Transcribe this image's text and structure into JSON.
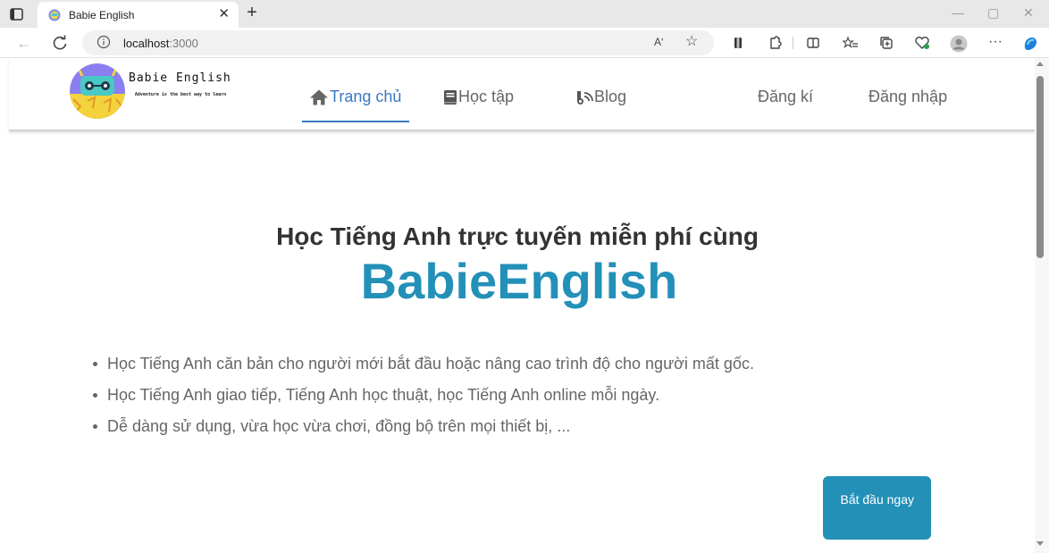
{
  "browser": {
    "tab_title": "Babie English",
    "url_host": "localhost",
    "url_port": ":3000",
    "read_aloud_label": "Aʹ"
  },
  "site": {
    "brand_name": "Babie English",
    "brand_slogan": "Adventure is the best way to learn",
    "nav": {
      "home": "Trang chủ",
      "study": "Học tập",
      "blog": "Blog",
      "register": "Đăng kí",
      "login": "Đăng nhập"
    },
    "hero": {
      "title": "Học Tiếng Anh trực tuyến miễn phí cùng",
      "brand": "BabieEnglish",
      "features": [
        "Học Tiếng Anh căn bản cho người mới bắt đầu hoặc nâng cao trình độ cho người mất gốc.",
        "Học Tiếng Anh giao tiếp, Tiếng Anh học thuật, học Tiếng Anh online mỗi ngày.",
        "Dễ dàng sử dụng, vừa học vừa chơi, đồng bộ trên mọi thiết bị, ..."
      ],
      "start_button": "Bắt đầu ngay"
    }
  },
  "colors": {
    "accent_blue": "#2390b8",
    "nav_active": "#3a78c3",
    "nav_text": "#666666",
    "heading": "#333333"
  },
  "icons": {
    "home": "home-icon",
    "study": "book-icon",
    "blog": "blog-icon"
  }
}
